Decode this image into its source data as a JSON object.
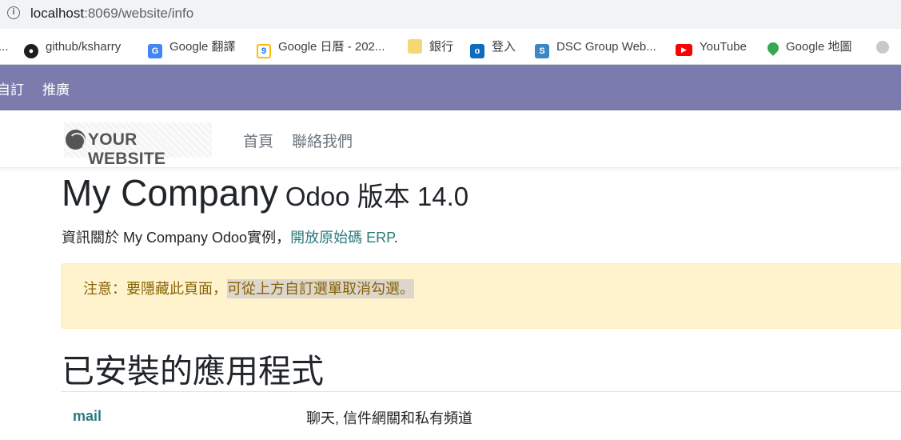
{
  "browser": {
    "url_host": "localhost",
    "url_path": ":8069/website/info"
  },
  "bookmarks": [
    {
      "label": "...",
      "icon": "none"
    },
    {
      "label": "github/ksharry",
      "icon": "github-icon"
    },
    {
      "label": "Google 翻譯",
      "icon": "google-translate-icon"
    },
    {
      "label": "Google 日曆 - 202...",
      "icon": "google-calendar-icon"
    },
    {
      "label": "銀行",
      "icon": "folder-icon"
    },
    {
      "label": "登入",
      "icon": "outlook-icon"
    },
    {
      "label": "DSC Group Web...",
      "icon": "dsc-icon"
    },
    {
      "label": "YouTube",
      "icon": "youtube-icon"
    },
    {
      "label": "Google 地圖",
      "icon": "google-maps-icon"
    }
  ],
  "odoo_nav": {
    "items": [
      "自訂",
      "推廣"
    ]
  },
  "site": {
    "logo_text": "YOUR WEBSITE",
    "menu": [
      "首頁",
      "聯絡我們"
    ]
  },
  "content": {
    "title_company": "My Company",
    "title_version": "Odoo 版本 14.0",
    "intro_text": "資訊關於 My Company Odoo實例，",
    "intro_link": "開放原始碼 ERP",
    "intro_end": ".",
    "alert_plain": "注意：要隱藏此頁面，",
    "alert_highlight": "可從上方自訂選單取消勾選。",
    "section_title": "已安裝的應用程式",
    "apps": [
      {
        "name": "mail",
        "description": "聊天, 信件網關和私有頻道"
      }
    ]
  },
  "colors": {
    "odoo_nav_bg": "#7c7bad",
    "alert_bg": "#fff3cd",
    "alert_text": "#856404",
    "link": "#2c7a7b"
  }
}
